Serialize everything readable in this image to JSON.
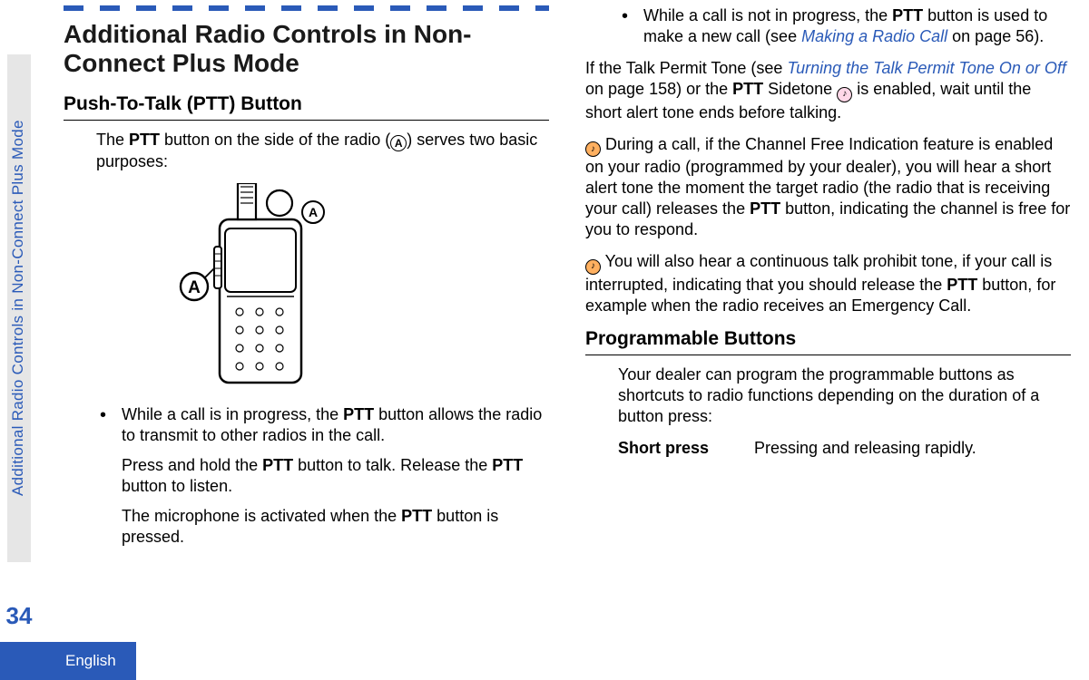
{
  "sidebar": {
    "section_label": "Additional Radio Controls in Non-Connect Plus Mode",
    "page_number": "34",
    "language": "English"
  },
  "title": "Additional Radio Controls in Non-Connect Plus Mode",
  "sub_ptt": "Push-To-Talk (PTT) Button",
  "intro_a": "The ",
  "intro_b": " button on the side of the radio (",
  "intro_c": ") serves two basic purposes:",
  "ptt": "PTT",
  "A": "A",
  "bullet1_a": "While a call is in progress, the ",
  "bullet1_b": " button allows the radio to transmit to other radios in the call.",
  "bullet1_p2_a": "Press and hold the ",
  "bullet1_p2_b": " button to talk. Release the ",
  "bullet1_p2_c": " button to listen.",
  "bullet1_p3_a": "The microphone is activated when the ",
  "bullet1_p3_b": " button is pressed.",
  "bullet2_a": "While a call is not in progress, the ",
  "bullet2_b": " button is used to make a new call (see ",
  "link1_text": "Making a Radio Call",
  "bullet2_c": " on page 56).",
  "para_permit_a": "If the Talk Permit Tone (see ",
  "link2_text": "Turning the Talk Permit Tone On or Off",
  "para_permit_b": " on page 158) or the ",
  "para_permit_c": " Sidetone ",
  "para_permit_d": " is enabled, wait until the short alert tone ends before talking.",
  "para_free_a": " During a call, if the Channel Free Indication feature is enabled on your radio (programmed by your dealer), you will hear a short alert tone the moment the target radio (the radio that is receiving your call) releases the ",
  "para_free_b": " button, indicating the channel is free for you to respond.",
  "para_prohibit_a": " You will also hear a continuous talk prohibit tone, if your call is interrupted, indicating that you should release the ",
  "para_prohibit_b": " button, for example when the radio receives an Emergency Call.",
  "sub_prog": "Programmable Buttons",
  "prog_intro": "Your dealer can program the programmable buttons as shortcuts to radio functions depending on the duration of a button press:",
  "def_term": "Short press",
  "def_desc": "Pressing and releasing rapidly."
}
